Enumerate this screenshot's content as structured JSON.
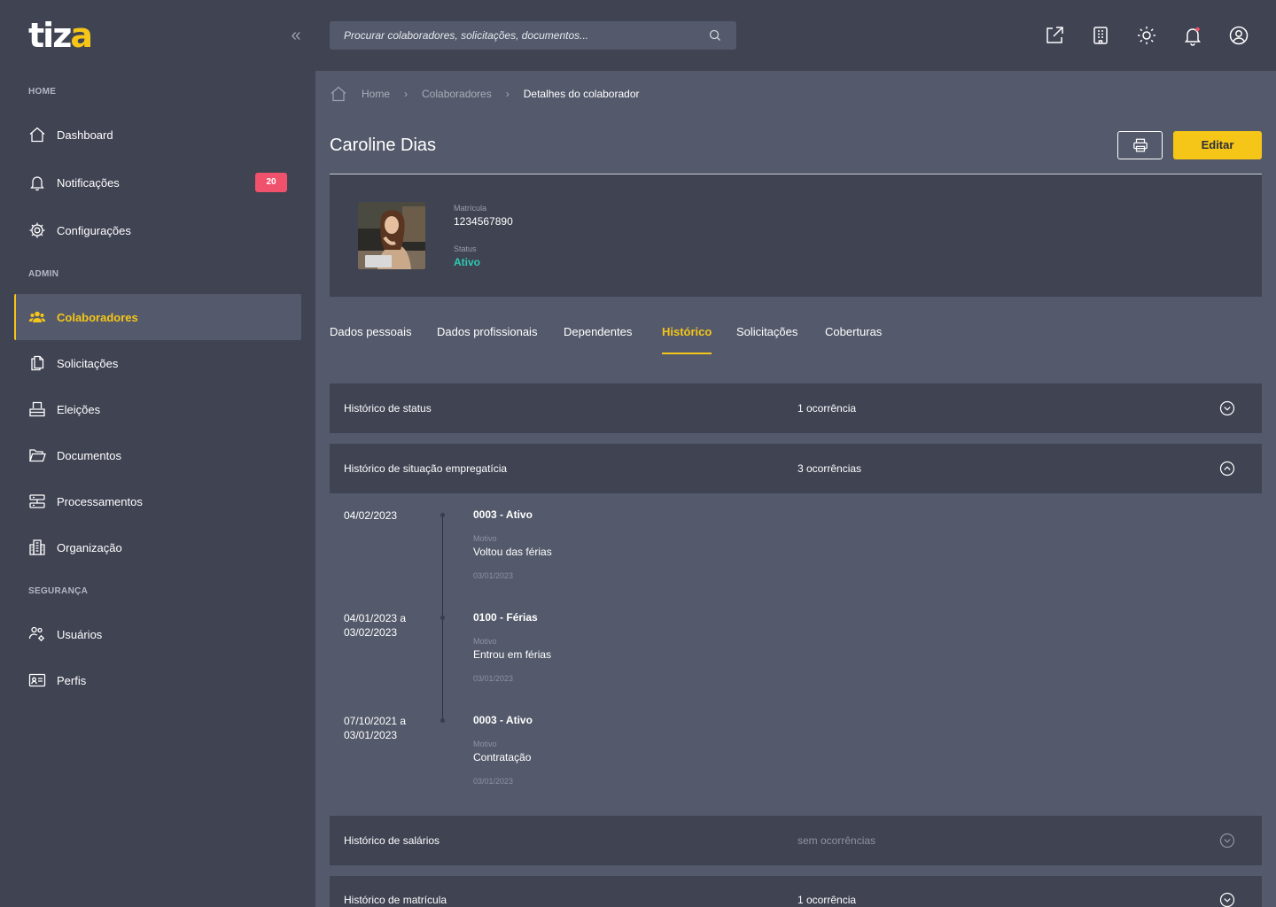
{
  "app": {
    "logo_main": "tiz",
    "logo_accent": "a"
  },
  "sidebar": {
    "sections": {
      "home": "HOME",
      "admin": "ADMIN",
      "security": "SEGURANÇA"
    },
    "items": [
      {
        "label": "Dashboard",
        "icon": "home-icon"
      },
      {
        "label": "Notificações",
        "icon": "bell-icon",
        "badge": "20"
      },
      {
        "label": "Configurações",
        "icon": "gear-icon"
      },
      {
        "label": "Colaboradores",
        "icon": "users-icon",
        "active": true
      },
      {
        "label": "Solicitações",
        "icon": "copy-icon"
      },
      {
        "label": "Eleições",
        "icon": "ballot-icon"
      },
      {
        "label": "Documentos",
        "icon": "folder-icon"
      },
      {
        "label": "Processamentos",
        "icon": "server-icon"
      },
      {
        "label": "Organização",
        "icon": "building-icon"
      },
      {
        "label": "Usuários",
        "icon": "user-gear-icon"
      },
      {
        "label": "Perfis",
        "icon": "id-card-icon"
      }
    ]
  },
  "search": {
    "placeholder": "Procurar colaboradores, solicitações, documentos..."
  },
  "breadcrumb": {
    "home": "Home",
    "colaboradores": "Colaboradores",
    "current": "Detalhes do colaborador"
  },
  "page": {
    "title": "Caroline Dias",
    "edit_label": "Editar"
  },
  "profile": {
    "matricula_label": "Matrícula",
    "matricula": "1234567890",
    "status_label": "Status",
    "status": "Ativo"
  },
  "tabs": [
    {
      "label": "Dados pessoais"
    },
    {
      "label": "Dados profissionais"
    },
    {
      "label": "Dependentes"
    },
    {
      "label": "Histórico",
      "active": true
    },
    {
      "label": "Solicitações"
    },
    {
      "label": "Coberturas"
    }
  ],
  "accordions": [
    {
      "title": "Histórico de status",
      "count": "1 ocorrência",
      "expanded": false
    },
    {
      "title": "Histórico de situação empregatícia",
      "count": "3 ocorrências",
      "expanded": true
    },
    {
      "title": "Histórico de salários",
      "count": "sem ocorrências",
      "expanded": false
    },
    {
      "title": "Histórico de matrícula",
      "count": "1 ocorrência",
      "expanded": false
    }
  ],
  "timeline": [
    {
      "date": "04/02/2023",
      "code": "0003 - Ativo",
      "motivo_label": "Motivo",
      "reason": "Voltou das férias",
      "registered": "03/01/2023"
    },
    {
      "date": "04/01/2023 a\n03/02/2023",
      "code": "0100 - Férias",
      "motivo_label": "Motivo",
      "reason": "Entrou em férias",
      "registered": "03/01/2023"
    },
    {
      "date": "07/10/2021 a\n03/01/2023",
      "code": "0003 - Ativo",
      "motivo_label": "Motivo",
      "reason": "Contratação",
      "registered": "03/01/2023"
    }
  ],
  "colors": {
    "accent": "#f5c518",
    "status_active": "#2ecab3",
    "badge": "#f0516b",
    "sidebar_bg": "#3f4352",
    "main_bg": "#545a6b"
  }
}
